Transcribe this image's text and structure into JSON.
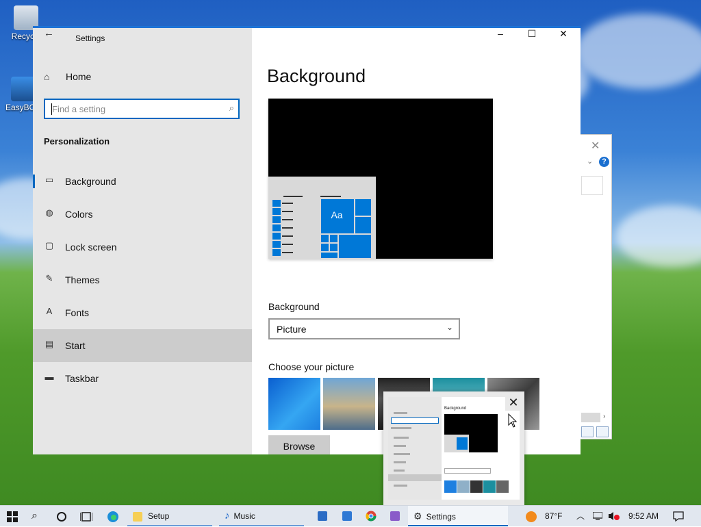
{
  "desktop": {
    "icons": [
      {
        "label": "Recycle"
      },
      {
        "label": "EasyBCD"
      }
    ]
  },
  "window": {
    "app_title": "Settings",
    "back_icon": "back-arrow-icon",
    "controls": {
      "minimize": "–",
      "maximize": "☐",
      "close": "✕"
    }
  },
  "sidebar": {
    "home_label": "Home",
    "search_placeholder": "Find a setting",
    "section_title": "Personalization",
    "items": [
      {
        "label": "Background",
        "icon": "picture-icon",
        "glyph": "▭"
      },
      {
        "label": "Colors",
        "icon": "palette-icon",
        "glyph": "◍"
      },
      {
        "label": "Lock screen",
        "icon": "lock-screen-icon",
        "glyph": "▢"
      },
      {
        "label": "Themes",
        "icon": "themes-icon",
        "glyph": "✎"
      },
      {
        "label": "Fonts",
        "icon": "fonts-icon",
        "glyph": "A"
      },
      {
        "label": "Start",
        "icon": "start-icon",
        "glyph": "▤"
      },
      {
        "label": "Taskbar",
        "icon": "taskbar-icon",
        "glyph": "▬"
      }
    ],
    "selected": "Background",
    "hovered": "Start"
  },
  "main": {
    "title": "Background",
    "preview_tile_text": "Aa",
    "background_label": "Background",
    "background_value": "Picture",
    "choose_label": "Choose your picture",
    "browse_label": "Browse",
    "accent_color": "#0078d7"
  },
  "thumbnail_popup": {
    "close_glyph": "✕",
    "mini_title": "Background"
  },
  "taskbar": {
    "apps": [
      {
        "label": "Setup"
      },
      {
        "label": "Music"
      },
      {
        "label": "Settings"
      }
    ],
    "weather": "87°F",
    "clock": "9:52 AM"
  }
}
